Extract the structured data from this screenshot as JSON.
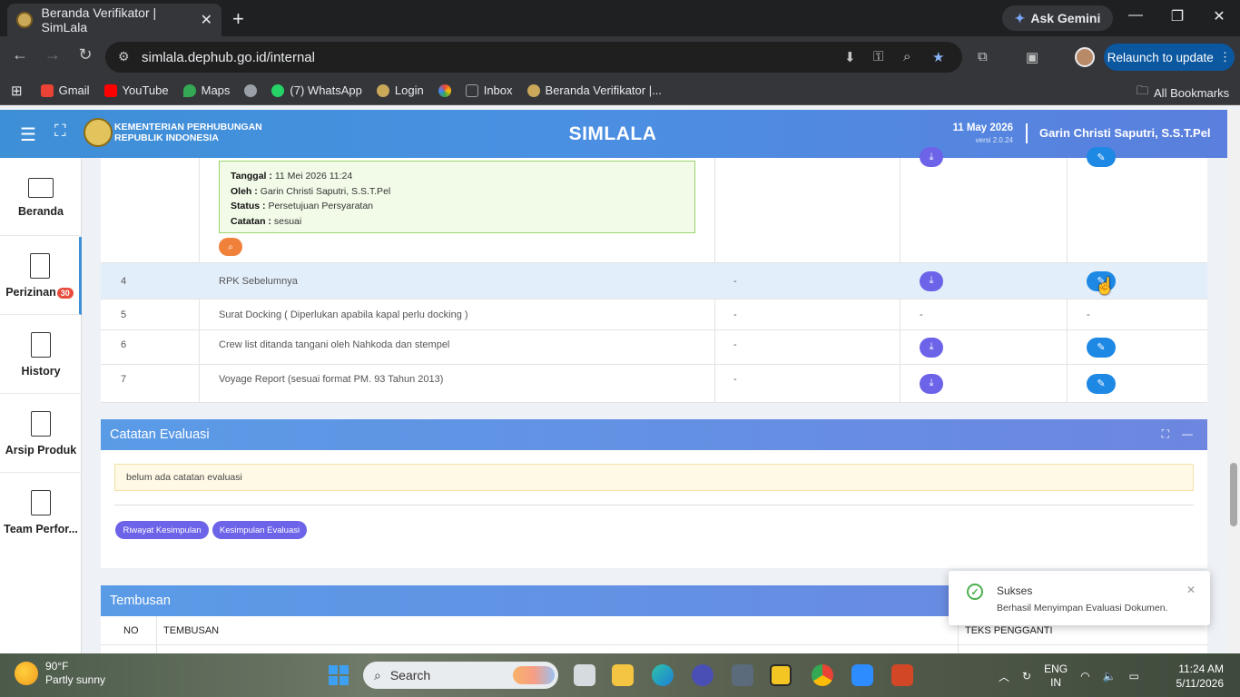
{
  "browser": {
    "tab_title": "Beranda Verifikator | SimLala",
    "tab_close": "✕",
    "new_tab": "+",
    "ask_gemini": "Ask Gemini",
    "url": "simlala.dephub.go.id/internal",
    "relaunch": "Relaunch to update",
    "window_buttons": [
      "—",
      "❐",
      "✕"
    ],
    "bookmarks": [
      {
        "label": "Gmail",
        "color": "#ea4335"
      },
      {
        "label": "YouTube",
        "color": "#ff0000"
      },
      {
        "label": "Maps",
        "color": "#34a853"
      },
      {
        "label": "",
        "color": "#9aa0a6"
      },
      {
        "label": "(7) WhatsApp",
        "color": "#25d366"
      },
      {
        "label": "Login",
        "color": "#c9a85a"
      },
      {
        "label": "",
        "color": "#f4b400"
      },
      {
        "label": "Inbox",
        "color": "#9aa0a6"
      },
      {
        "label": "Beranda Verifikator |...",
        "color": "#c9a85a"
      }
    ],
    "all_bookmarks": "All Bookmarks"
  },
  "header": {
    "ministry_line1": "KEMENTERIAN PERHUBUNGAN",
    "ministry_line2": "REPUBLIK INDONESIA",
    "title": "SIMLALA",
    "date": "11 May 2026",
    "version": "versi 2.0.24",
    "user": "Garin Christi Saputri, S.S.T.Pel"
  },
  "sidebar": [
    {
      "label": "Beranda",
      "icon": "monitor-icon"
    },
    {
      "label": "Perizinan",
      "icon": "document-icon",
      "badge": "30"
    },
    {
      "label": "History",
      "icon": "document-icon"
    },
    {
      "label": "Arsip Produk",
      "icon": "document-icon"
    },
    {
      "label": "Team Perfor...",
      "icon": "document-icon"
    }
  ],
  "info": {
    "tanggal_label": "Tanggal :",
    "tanggal": "11 Mei 2026 11:24",
    "oleh_label": "Oleh :",
    "oleh": "Garin Christi Saputri, S.S.T.Pel",
    "status_label": "Status :",
    "status": "Persetujuan Persyaratan",
    "catatan_label": "Catatan :",
    "catatan": "sesuai"
  },
  "rows": [
    {
      "no": "4",
      "doc": "RPK Sebelumnya",
      "ket": "-"
    },
    {
      "no": "5",
      "doc": "Surat Docking ( Diperlukan apabila kapal perlu docking )",
      "ket": "-",
      "dl": "-",
      "ed": "-"
    },
    {
      "no": "6",
      "doc": "Crew list ditanda tangani oleh Nahkoda dan stempel",
      "ket": "-"
    },
    {
      "no": "7",
      "doc": "Voyage Report (sesuai format PM. 93 Tahun 2013)",
      "ket": "-"
    }
  ],
  "catatan_evaluasi": {
    "title": "Catatan Evaluasi",
    "note": "belum ada catatan evaluasi",
    "btn_riwayat": "Riwayat Kesimpulan",
    "btn_kesimpulan": "Kesimpulan Evaluasi"
  },
  "tembusan": {
    "title": "Tembusan",
    "col_no": "NO",
    "col_tembusan": "TEMBUSAN",
    "col_teks": "TEKS PENGGANTI"
  },
  "toast": {
    "title": "Sukses",
    "message": "Berhasil Menyimpan Evaluasi Dokumen."
  },
  "taskbar": {
    "temp": "90°F",
    "weather": "Partly sunny",
    "search": "Search",
    "lang1": "ENG",
    "lang2": "IN",
    "time": "11:24 AM",
    "date": "5/11/2026"
  }
}
